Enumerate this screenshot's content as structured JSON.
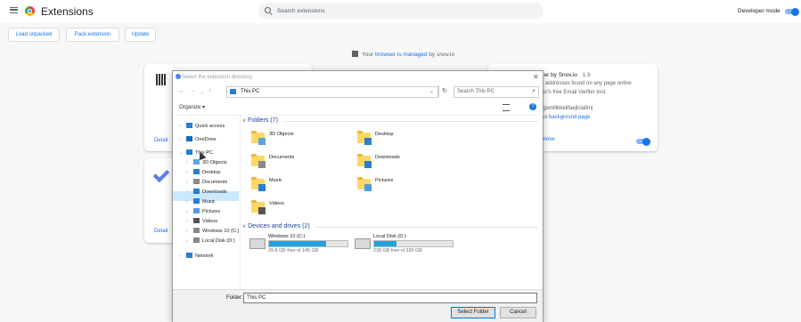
{
  "header": {
    "title": "Extensions",
    "search_placeholder": "Search extensions",
    "developer_mode_label": "Developer mode",
    "developer_mode_on": true
  },
  "toolbar": {
    "load_unpacked": "Load unpacked",
    "pack_extension": "Pack extension",
    "update": "Update"
  },
  "managed_notice": {
    "prefix": "Your",
    "link": "browser is managed",
    "suffix": "by snov.io"
  },
  "cards": {
    "details_label": "Detail",
    "right_card": {
      "name": "Verifier by Snov.io",
      "version": "1.9",
      "desc_line1": "email addresses found on any page online",
      "desc_line2": "snov.io's free Email Verifier tool.",
      "id": "hbaegomlllbkelifaejlclaifmj",
      "views_prefix": "t views",
      "views_link": "background page",
      "remove_label": "move"
    }
  },
  "dialog": {
    "title": "Select the extension directory.",
    "close": "✕",
    "address": "This PC",
    "search_placeholder": "Search This PC",
    "organize": "Organize ▾",
    "nav": [
      {
        "label": "Quick access",
        "icon": "star-icon"
      },
      {
        "label": "OneDrive",
        "icon": "cloud-icon"
      },
      {
        "label": "This PC",
        "icon": "pc-icon"
      },
      {
        "label": "3D Objects",
        "icon": "cube-icon"
      },
      {
        "label": "Desktop",
        "icon": "desktop-icon"
      },
      {
        "label": "Documents",
        "icon": "document-icon"
      },
      {
        "label": "Downloads",
        "icon": "download-icon"
      },
      {
        "label": "Music",
        "icon": "music-icon"
      },
      {
        "label": "Pictures",
        "icon": "picture-icon"
      },
      {
        "label": "Videos",
        "icon": "video-icon"
      },
      {
        "label": "Windows 10 (C:)",
        "icon": "drive-icon"
      },
      {
        "label": "Local Disk (D:)",
        "icon": "drive-icon"
      },
      {
        "label": "Network",
        "icon": "network-icon"
      }
    ],
    "folders_header": "Folders (7)",
    "folders": [
      {
        "label": "3D Objects",
        "icon": "cube-icon"
      },
      {
        "label": "Desktop",
        "icon": "desktop-icon"
      },
      {
        "label": "Documents",
        "icon": "document-icon"
      },
      {
        "label": "Downloads",
        "icon": "download-icon"
      },
      {
        "label": "Music",
        "icon": "music-icon"
      },
      {
        "label": "Pictures",
        "icon": "picture-icon"
      },
      {
        "label": "Videos",
        "icon": "video-icon"
      }
    ],
    "drives_header": "Devices and drives (2)",
    "drives": [
      {
        "label": "Windows 10 (C:)",
        "free": "39.8 GB free of 145 GB",
        "used_fraction": 0.73
      },
      {
        "label": "Local Disk (D:)",
        "free": "238 GB free of 330 GB",
        "used_fraction": 0.28
      }
    ],
    "folder_label": "Folder:",
    "folder_value": "This PC",
    "select_button": "Select Folder",
    "cancel_button": "Cancel"
  },
  "colors": {
    "accent": "#1a73e8",
    "selection": "#cce8ff",
    "folder": "#ffd766",
    "drive_bar": "#26a0da"
  }
}
